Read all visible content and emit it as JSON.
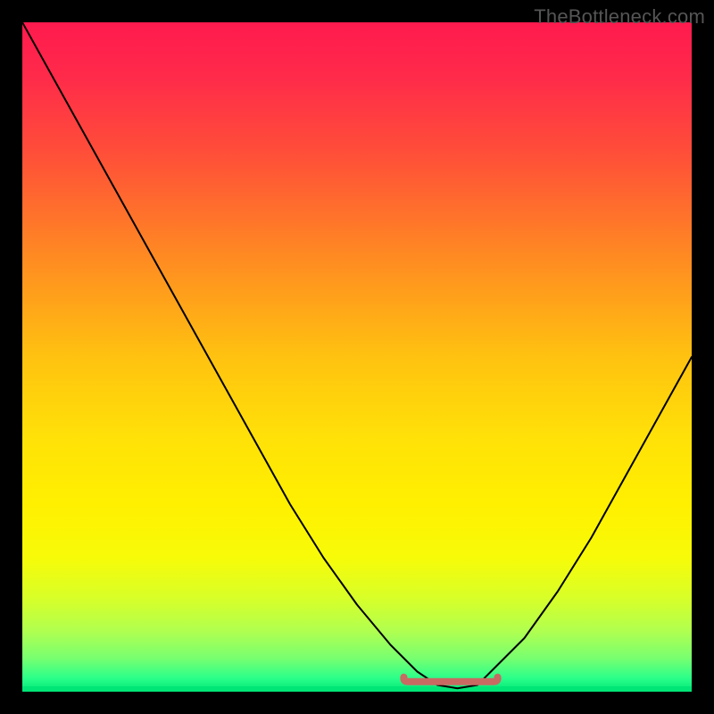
{
  "watermark": "TheBottleneck.com",
  "chart_data": {
    "type": "line",
    "title": "",
    "xlabel": "",
    "ylabel": "",
    "xlim": [
      0,
      100
    ],
    "ylim": [
      0,
      100
    ],
    "grid": false,
    "gradient_stops": [
      {
        "offset": 0.0,
        "color": "#ff1a4e"
      },
      {
        "offset": 0.08,
        "color": "#ff2a4a"
      },
      {
        "offset": 0.2,
        "color": "#ff5038"
      },
      {
        "offset": 0.35,
        "color": "#ff8a22"
      },
      {
        "offset": 0.5,
        "color": "#ffc210"
      },
      {
        "offset": 0.62,
        "color": "#ffe108"
      },
      {
        "offset": 0.72,
        "color": "#fff000"
      },
      {
        "offset": 0.8,
        "color": "#f7fb08"
      },
      {
        "offset": 0.86,
        "color": "#d8ff28"
      },
      {
        "offset": 0.91,
        "color": "#b0ff50"
      },
      {
        "offset": 0.95,
        "color": "#78ff70"
      },
      {
        "offset": 0.98,
        "color": "#2aff8a"
      },
      {
        "offset": 1.0,
        "color": "#00e676"
      }
    ],
    "x": [
      0,
      5,
      10,
      15,
      20,
      25,
      30,
      35,
      40,
      45,
      50,
      55,
      59,
      62,
      65,
      68,
      70,
      75,
      80,
      85,
      90,
      95,
      100
    ],
    "values": [
      100,
      91,
      82,
      73,
      64,
      55,
      46,
      37,
      28,
      20,
      13,
      7,
      3,
      1,
      0.5,
      1,
      3,
      8,
      15,
      23,
      32,
      41,
      50
    ],
    "optimal_band": {
      "x_start": 57,
      "x_end": 71,
      "y": 1.5
    },
    "optimal_band_color": "#c86a62"
  }
}
